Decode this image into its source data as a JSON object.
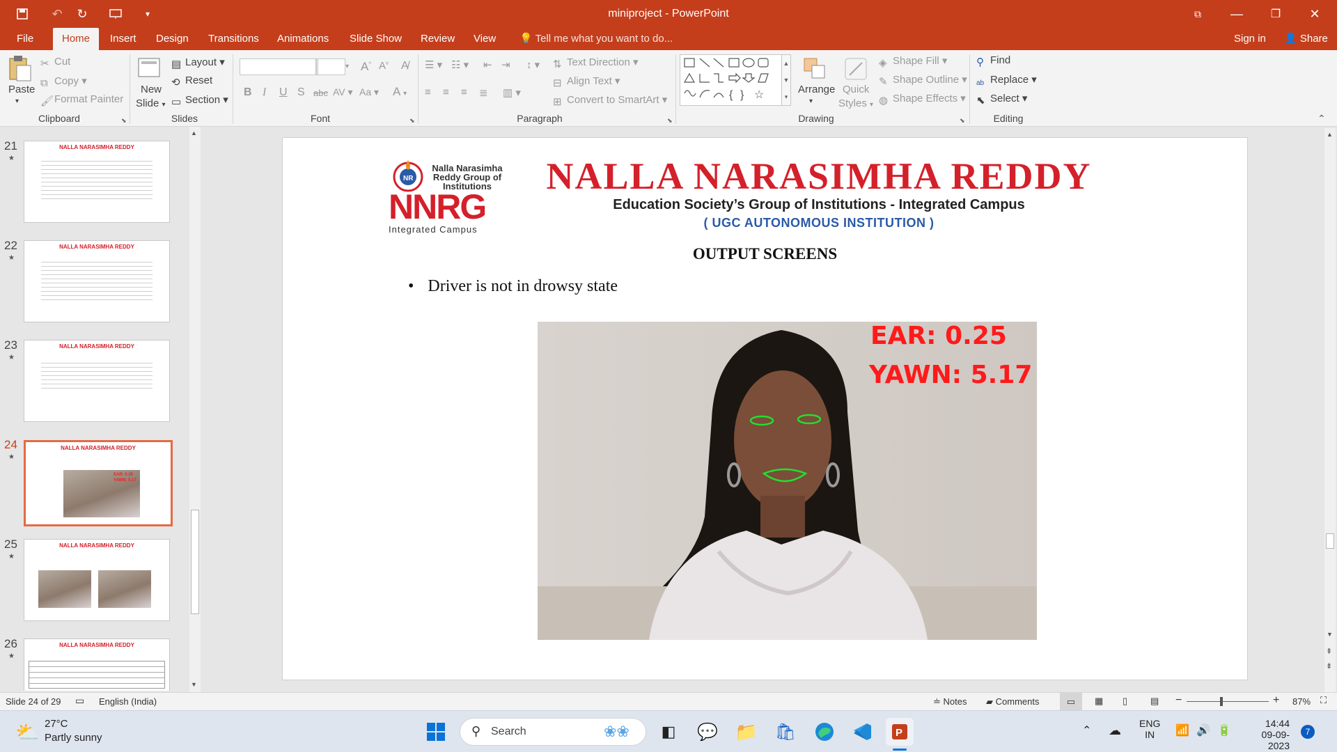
{
  "window": {
    "title": "miniproject - PowerPoint",
    "sign_in": "Sign in",
    "share": "Share"
  },
  "tabs": [
    "File",
    "Home",
    "Insert",
    "Design",
    "Transitions",
    "Animations",
    "Slide Show",
    "Review",
    "View"
  ],
  "tell_me": "Tell me what you want to do...",
  "clipboard": {
    "paste": "Paste",
    "cut": "Cut",
    "copy": "Copy",
    "format_painter": "Format Painter",
    "group": "Clipboard"
  },
  "slides_group": {
    "new_slide_1": "New",
    "new_slide_2": "Slide",
    "layout": "Layout",
    "reset": "Reset",
    "section": "Section",
    "group": "Slides"
  },
  "font_group": {
    "group": "Font"
  },
  "paragraph_group": {
    "text_direction": "Text Direction",
    "align_text": "Align Text",
    "convert_smartart": "Convert to SmartArt",
    "group": "Paragraph"
  },
  "drawing_group": {
    "arrange": "Arrange",
    "quick_1": "Quick",
    "quick_2": "Styles",
    "shape_fill": "Shape Fill",
    "shape_outline": "Shape Outline",
    "shape_effects": "Shape Effects",
    "group": "Drawing"
  },
  "editing_group": {
    "find": "Find",
    "replace": "Replace",
    "select": "Select",
    "group": "Editing"
  },
  "thumbnails": [
    {
      "num": "21"
    },
    {
      "num": "22"
    },
    {
      "num": "23"
    },
    {
      "num": "24"
    },
    {
      "num": "25"
    },
    {
      "num": "26"
    }
  ],
  "thumb_header": "NALLA NARASIMHA REDDY",
  "slide": {
    "logo_line1": "Nalla Narasimha",
    "logo_line2": "Reddy Group of",
    "logo_line3": "Institutions",
    "logo_big": "NNRG",
    "logo_sub": "Integrated Campus",
    "header_title": "NALLA NARASIMHA REDDY",
    "header_sub": "Education Society’s Group of Institutions - Integrated Campus",
    "header_ugc": "( UGC AUTONOMOUS INSTITUTION )",
    "heading": "OUTPUT SCREENS",
    "bullet": "Driver is not in drowsy state",
    "ear": "EAR: 0.25",
    "yawn": "YAWN: 5.17"
  },
  "status": {
    "slide_info": "Slide 24 of 29",
    "language": "English (India)",
    "notes": "Notes",
    "comments": "Comments",
    "zoom": "87%"
  },
  "taskbar": {
    "temp": "27°C",
    "weather": "Partly sunny",
    "search": "Search",
    "lang1": "ENG",
    "lang2": "IN",
    "time": "14:44",
    "date": "09-09-2023",
    "badge": "7"
  },
  "colors": {
    "accent": "#c43e1c",
    "nnrg_red": "#d4202a",
    "ugc_blue": "#2a5aa8",
    "detector_green": "#22e030",
    "overlay_red": "#ff1a1a"
  }
}
